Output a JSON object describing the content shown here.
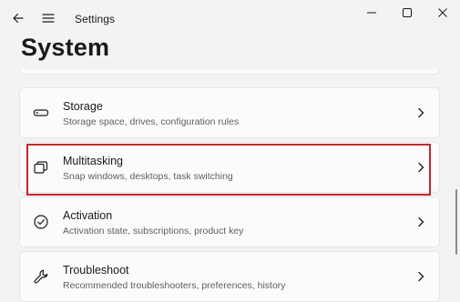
{
  "window": {
    "app_title": "Settings",
    "page_title": "System",
    "icons": {
      "back": "back-arrow-icon",
      "menu": "hamburger-menu-icon",
      "minimize": "minimize-icon",
      "maximize": "maximize-icon",
      "close": "close-icon"
    }
  },
  "settings_items": [
    {
      "title": "Storage",
      "subtitle": "Storage space, drives, configuration rules",
      "icon": "storage-drive-icon"
    },
    {
      "title": "Multitasking",
      "subtitle": "Snap windows, desktops, task switching",
      "icon": "multitasking-icon",
      "highlighted": true
    },
    {
      "title": "Activation",
      "subtitle": "Activation state, subscriptions, product key",
      "icon": "activation-check-icon"
    },
    {
      "title": "Troubleshoot",
      "subtitle": "Recommended troubleshooters, preferences, history",
      "icon": "wrench-icon"
    }
  ],
  "colors": {
    "highlight_border": "#c4262e",
    "background": "#f3f3f3",
    "card": "#fbfbfb"
  }
}
